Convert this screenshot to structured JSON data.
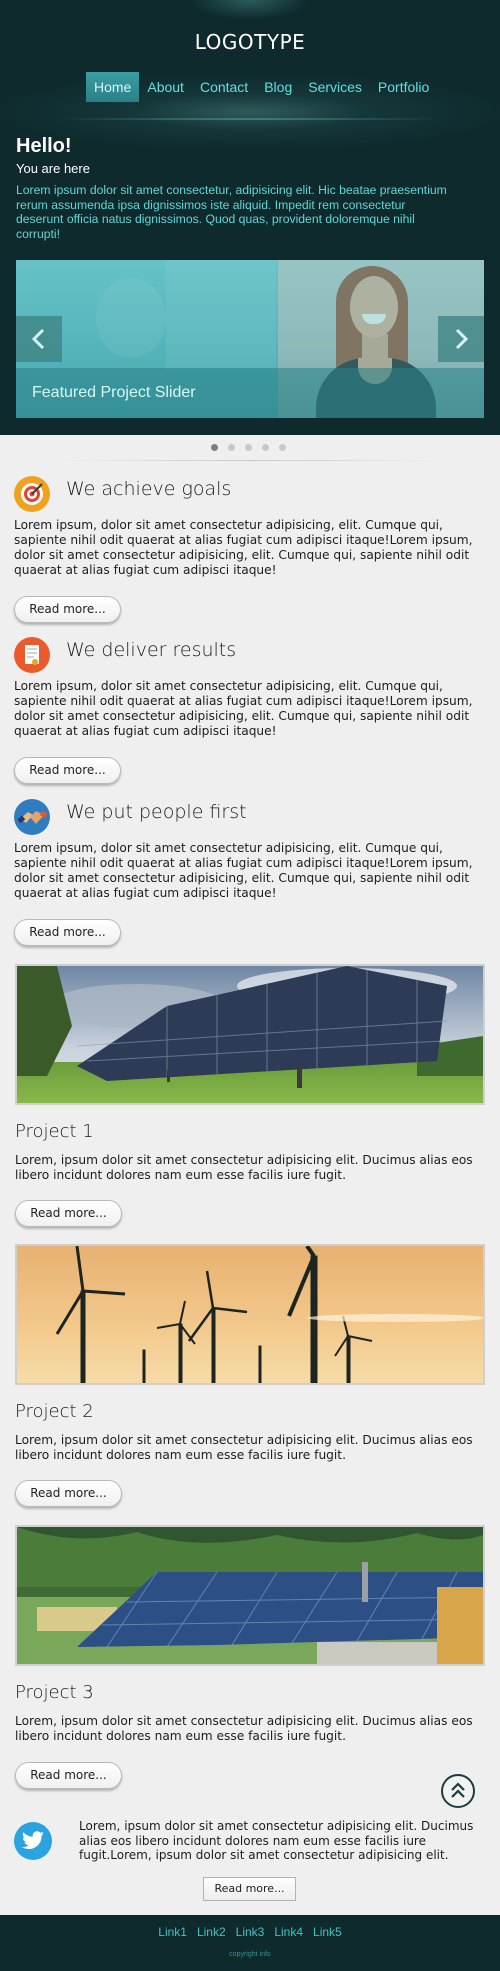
{
  "header": {
    "logo": "LOGOTYPE",
    "nav": [
      "Home",
      "About",
      "Contact",
      "Blog",
      "Services",
      "Portfolio"
    ],
    "active_nav": "Home"
  },
  "hero": {
    "title": "Hello!",
    "subtitle": "You are here",
    "intro": "Lorem ipsum dolor sit amet consectetur, adipisicing elit. Hic beatae praesentium rerum assumenda ipsa dignissimos iste aliquid. Impedit rem consectetur deserunt officia natus dignissimos. Quod quas, provident doloremque nihil corrupti!"
  },
  "slider": {
    "caption": "Featured Project Slider",
    "dot_count": 5,
    "active_dot": 1
  },
  "features": [
    {
      "icon": "target-icon",
      "title": "We achieve goals",
      "text": "Lorem ipsum, dolor sit amet consectetur adipisicing, elit. Cumque qui, sapiente nihil odit quaerat at alias fugiat cum adipisci itaque!Lorem ipsum, dolor sit amet consectetur adipisicing, elit. Cumque qui, sapiente nihil odit quaerat at alias fugiat cum adipisci itaque!",
      "button": "Read more..."
    },
    {
      "icon": "document-icon",
      "title": "We deliver results",
      "text": "Lorem ipsum, dolor sit amet consectetur adipisicing, elit. Cumque qui, sapiente nihil odit quaerat at alias fugiat cum adipisci itaque!Lorem ipsum, dolor sit amet consectetur adipisicing, elit. Cumque qui, sapiente nihil odit quaerat at alias fugiat cum adipisci itaque!",
      "button": "Read more..."
    },
    {
      "icon": "handshake-icon",
      "title": "We put people first",
      "text": "Lorem ipsum, dolor sit amet consectetur adipisicing, elit. Cumque qui, sapiente nihil odit quaerat at alias fugiat cum adipisci itaque!Lorem ipsum, dolor sit amet consectetur adipisicing, elit. Cumque qui, sapiente nihil odit quaerat at alias fugiat cum adipisci itaque!",
      "button": "Read more..."
    }
  ],
  "projects": [
    {
      "image": "solar-field-image",
      "title": "Project 1",
      "text": "Lorem, ipsum dolor sit amet consectetur adipisicing elit. Ducimus alias eos libero incidunt dolores nam eum esse facilis iure fugit.",
      "button": "Read more..."
    },
    {
      "image": "wind-turbines-image",
      "title": "Project 2",
      "text": "Lorem, ipsum dolor sit amet consectetur adipisicing elit. Ducimus alias eos libero incidunt dolores nam eum esse facilis iure fugit.",
      "button": "Read more..."
    },
    {
      "image": "solar-roof-image",
      "title": "Project 3",
      "text": "Lorem, ipsum dolor sit amet consectetur adipisicing elit. Ducimus alias eos libero incidunt dolores nam eum esse facilis iure fugit.",
      "button": "Read more..."
    }
  ],
  "tweet": {
    "text": "Lorem, ipsum dolor sit amet consectetur adipisicing elit. Ducimus alias eos libero incidunt dolores nam eum esse facilis iure fugit.Lorem, ipsum dolor sit amet consectetur adipisicing elit.",
    "button": "Read more..."
  },
  "footer": {
    "links": [
      "Link1",
      "Link2",
      "Link3",
      "Link4",
      "Link5"
    ],
    "copyright": "copyright info"
  },
  "colors": {
    "header_bg": "#0e2a2d",
    "accent": "#5fe0e2",
    "page_bg": "#efefef"
  }
}
